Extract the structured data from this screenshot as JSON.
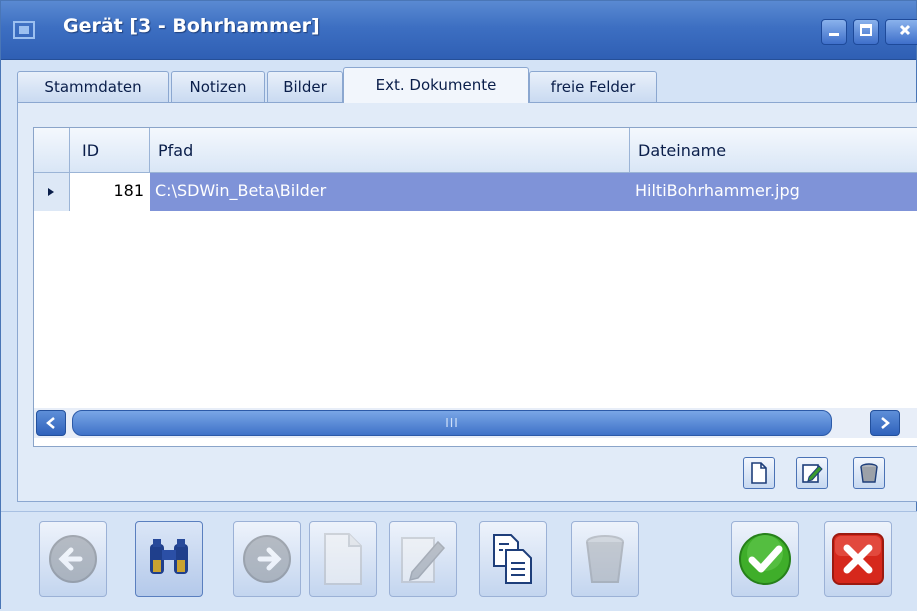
{
  "window": {
    "title": "Gerät [3 - Bohrhammer]"
  },
  "tabs": [
    {
      "label": "Stammdaten",
      "active": false
    },
    {
      "label": "Notizen",
      "active": false
    },
    {
      "label": "Bilder",
      "active": false
    },
    {
      "label": "Ext. Dokumente",
      "active": true
    },
    {
      "label": "freie Felder",
      "active": false
    }
  ],
  "grid": {
    "columns": [
      "ID",
      "Pfad",
      "Dateiname"
    ],
    "rows": [
      {
        "id": "181",
        "pfad": "C:\\SDWin_Beta\\Bilder",
        "dateiname": "HiltiBohrhammer.jpg",
        "selected": true
      }
    ],
    "scroll_thumb_label": "III"
  },
  "panel_buttons": [
    "new-document-icon",
    "edit-document-icon",
    "delete-trash-icon"
  ],
  "toolbar_buttons": [
    "back-arrow-icon",
    "binoculars-icon",
    "forward-arrow-icon",
    "new-document-icon",
    "edit-document-icon",
    "copy-document-icon",
    "delete-trash-icon",
    "ok-checkmark-icon",
    "cancel-x-icon"
  ],
  "colors": {
    "titlebar": "#3d6fc2",
    "selection": "#7f93d8",
    "ok_green": "#3fae2a",
    "cancel_red": "#d6281c"
  }
}
